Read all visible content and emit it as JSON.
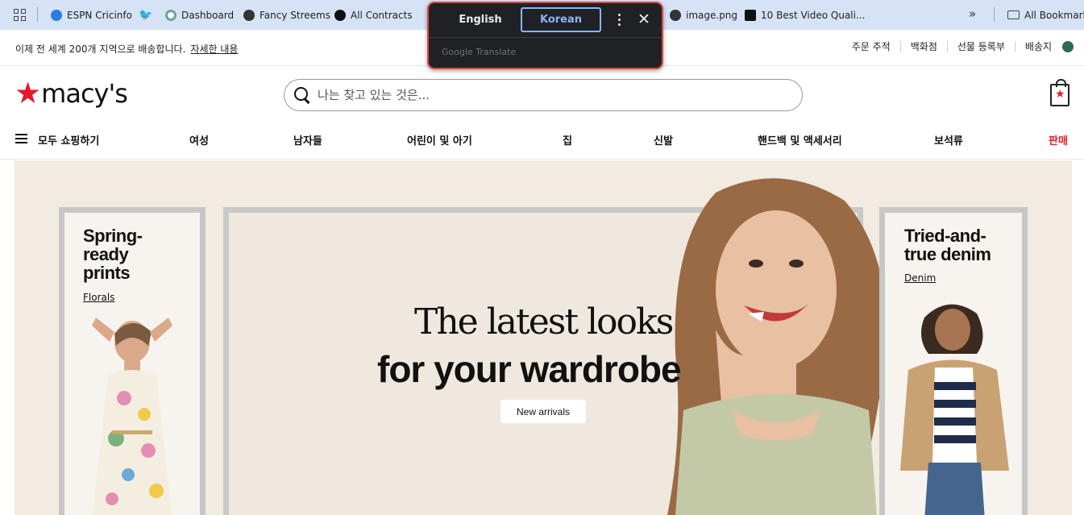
{
  "bookmarks": {
    "items": [
      {
        "label": "ESPN Cricinfo",
        "icon": "espn-globe-icon",
        "color": "#2a7de1"
      },
      {
        "label": "",
        "icon": "twitter-bird-icon",
        "color": "#1d9bf0"
      },
      {
        "label": "Dashboard",
        "icon": "dashboard-circle-icon",
        "color": "#6aa39a"
      },
      {
        "label": "Fancy Streems",
        "icon": "globe-icon",
        "color": "#333333"
      },
      {
        "label": "All Contracts",
        "icon": "upwork-icon",
        "color": "#111111"
      },
      {
        "label": "image.png",
        "icon": "globe-icon",
        "color": "#333333"
      },
      {
        "label": "10 Best Video Quali...",
        "icon": "site-icon",
        "color": "#111111"
      }
    ],
    "more": "»",
    "all_bookmarks": "All Bookmarks"
  },
  "translate_popup": {
    "source_lang": "English",
    "target_lang": "Korean",
    "footer": "Google Translate"
  },
  "utility": {
    "shipping": "이제 전 세계 200개 지역으로 배송합니다.",
    "details_link": "자세한 내용",
    "links": [
      "주문 추적",
      "백화점",
      "선물 등록부",
      "배송지"
    ]
  },
  "header": {
    "logo_text": "macy's",
    "search_placeholder": "나는 찾고 있는 것은..."
  },
  "nav": {
    "all": "모두 쇼핑하기",
    "items": [
      "여성",
      "남자들",
      "어린이 및 아기",
      "집",
      "신발",
      "핸드백 및 액세서리",
      "보석류",
      "판매"
    ]
  },
  "hero": {
    "left_title_1": "Spring-",
    "left_title_2": "ready",
    "left_title_3": "prints",
    "left_link": "Florals",
    "headline_1": "The latest looks",
    "headline_2": "for your wardrobe",
    "cta": "New arrivals",
    "right_title_1": "Tried-and-",
    "right_title_2": "true denim",
    "right_link": "Denim"
  },
  "colors": {
    "brand_red": "#e21a2c",
    "popup_bg": "#202124",
    "popup_highlight": "#e0443e",
    "active_lang": "#8ab4f8"
  }
}
